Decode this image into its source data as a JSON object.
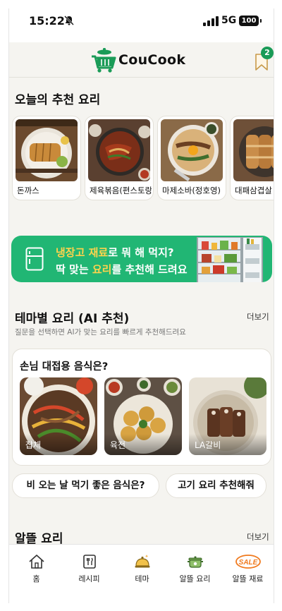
{
  "status_bar": {
    "time": "15:22",
    "network": "5G",
    "battery": "100"
  },
  "header": {
    "app_name": "CouCook",
    "bookmark_count": "2"
  },
  "today_recommend": {
    "title": "오늘의 추천 요리",
    "items": [
      {
        "label": "돈까스"
      },
      {
        "label": "제육볶음(편스토랑)"
      },
      {
        "label": "마제소바(정호영)"
      },
      {
        "label": "대패삼겹살"
      }
    ]
  },
  "banner": {
    "line1_highlight": "냉장고 재료",
    "line1_rest": "로 뭐 해 먹지?",
    "line2_start": "딱 맞는 ",
    "line2_highlight": "요리",
    "line2_rest": "를 추천해 드려요"
  },
  "theme_section": {
    "title": "테마별 요리 (AI 추천)",
    "more": "더보기",
    "subtitle": "질문을 선택하면 AI가 맞는 요리를 빠르게 추천해드려요",
    "card": {
      "question": "손님 대접용 음식은?",
      "dishes": [
        {
          "label": "잡채"
        },
        {
          "label": "육전"
        },
        {
          "label": "LA갈비"
        }
      ]
    },
    "chips": [
      {
        "label": "비 오는 날 먹기 좋은 음식은?"
      },
      {
        "label": "고기 요리 추천해줘"
      }
    ]
  },
  "budget_section": {
    "title": "알뜰 요리",
    "more": "더보기"
  },
  "tabbar": {
    "tabs": [
      {
        "label": "홈",
        "icon": "home-icon"
      },
      {
        "label": "레시피",
        "icon": "recipe-book-icon"
      },
      {
        "label": "테마",
        "icon": "cloche-icon"
      },
      {
        "label": "알뜰 요리",
        "icon": "pot-icon"
      },
      {
        "label": "알뜰 재료",
        "icon": "sale-tag-icon"
      }
    ],
    "sale_text": "SALE"
  },
  "colors": {
    "brand_green": "#1a9b57",
    "banner_green": "#21b674",
    "highlight_yellow": "#ffd34d",
    "sale_orange": "#f07a1e"
  }
}
